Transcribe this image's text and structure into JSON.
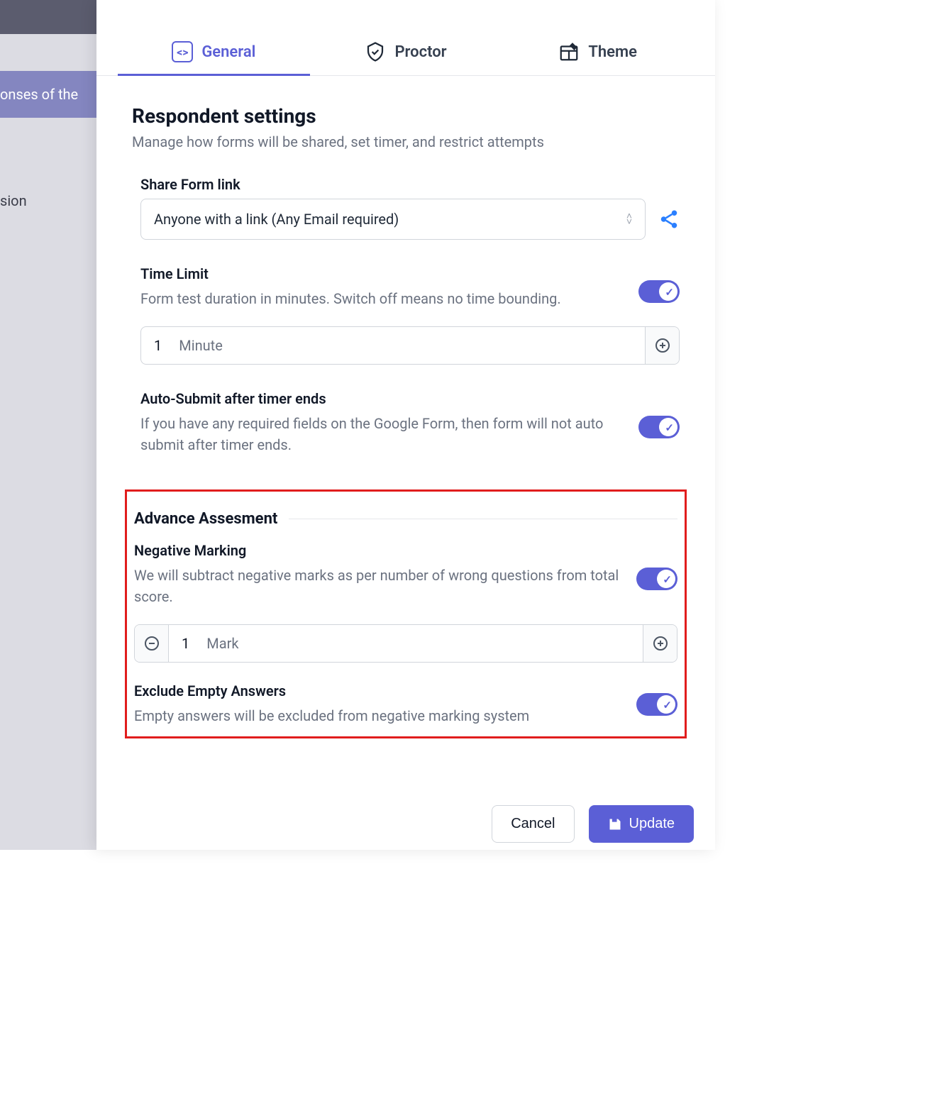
{
  "background": {
    "row1_text": "onses of the",
    "row2_text": "sion"
  },
  "tabs": [
    {
      "label": "General",
      "active": true
    },
    {
      "label": "Proctor",
      "active": false
    },
    {
      "label": "Theme",
      "active": false
    }
  ],
  "respondent": {
    "title": "Respondent settings",
    "subtitle": "Manage how forms will be shared, set timer, and restrict attempts",
    "share": {
      "label": "Share Form link",
      "value": "Anyone with a link (Any Email required)"
    },
    "timelimit": {
      "label": "Time Limit",
      "desc": "Form test duration in minutes. Switch off means no time bounding.",
      "value": "1",
      "unit": "Minute",
      "enabled": true
    },
    "autosubmit": {
      "label": "Auto-Submit after timer ends",
      "desc": "If you have any required fields on the Google Form, then form will not auto submit after timer ends.",
      "enabled": true
    }
  },
  "assessment": {
    "title": "Advance Assesment",
    "negative": {
      "label": "Negative Marking",
      "desc": "We will subtract negative marks as per number of wrong questions from total score.",
      "value": "1",
      "unit": "Mark",
      "enabled": true
    },
    "exclude": {
      "label": "Exclude Empty Answers",
      "desc": "Empty answers will be excluded from negative marking system",
      "enabled": true
    }
  },
  "footer": {
    "cancel": "Cancel",
    "update": "Update"
  }
}
